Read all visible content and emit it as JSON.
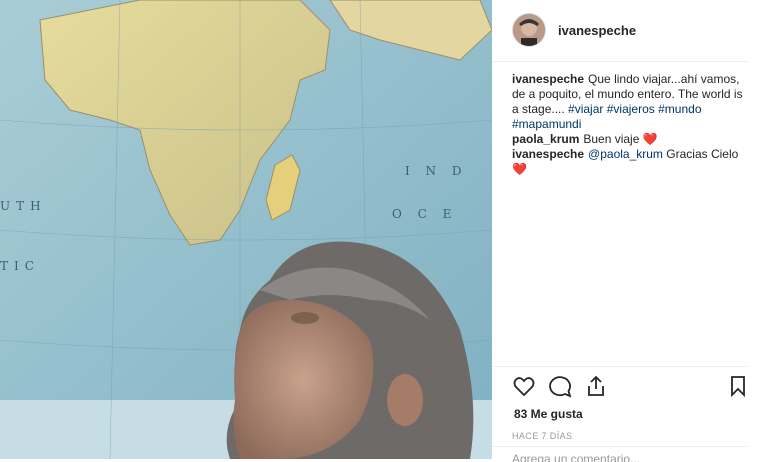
{
  "post": {
    "author": "ivanespeche",
    "photo_map_labels": [
      "I N D",
      "O C E",
      "UTH",
      "TIC"
    ],
    "caption": {
      "user": "ivanespeche",
      "text": "Que lindo viajar...ahí vamos, de a poquito, el mundo entero. The world is a stage.... ",
      "tags": [
        "#viajar",
        "#viajeros",
        "#mundo",
        "#mapamundi"
      ]
    },
    "comments": [
      {
        "user": "paola_krum",
        "text": "Buen viaje ",
        "heart": "❤️"
      },
      {
        "user": "ivanespeche",
        "mention": "@paola_krum",
        "text": " Gracias Cielo ",
        "heart": "❤️"
      }
    ],
    "likes": "83 Me gusta",
    "time_ago": "HACE 7 DÍAS",
    "add_comment_placeholder": "Agrega un comentario..."
  },
  "icons": {
    "like": "heart-icon",
    "comment": "comment-icon",
    "share": "share-icon",
    "save": "bookmark-icon"
  },
  "colors": {
    "text": "#262626",
    "hashtag": "#003569",
    "muted": "#999999",
    "heart": "#e0245e",
    "divider": "#efefef"
  }
}
